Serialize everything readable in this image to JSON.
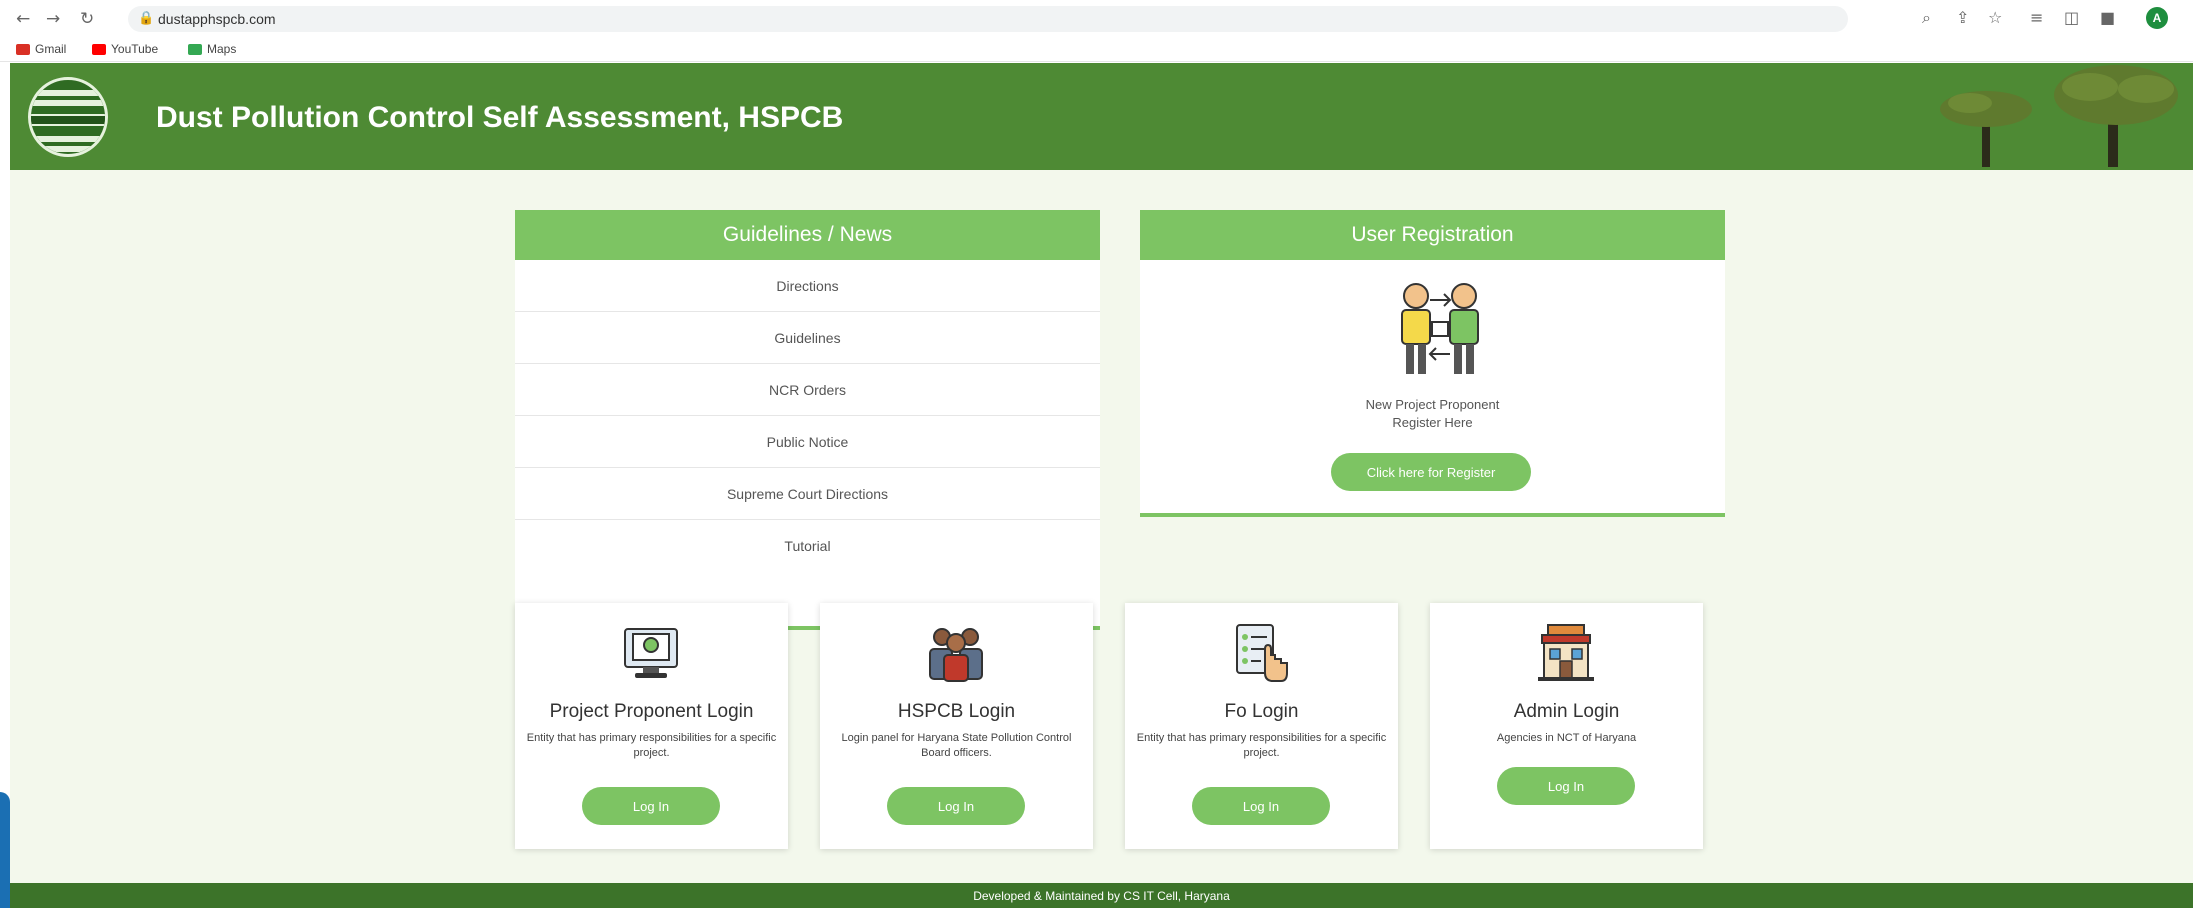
{
  "browser": {
    "url": "dustapphspcb.com",
    "bookmarks": [
      {
        "label": "Gmail",
        "color": "#d93025"
      },
      {
        "label": "YouTube",
        "color": "#ff0000"
      },
      {
        "label": "Maps",
        "color": "#34a853"
      }
    ],
    "avatar_letter": "A"
  },
  "header": {
    "title": "Dust Pollution Control Self Assessment, HSPCB",
    "bg_color": "#4e8a34"
  },
  "guidelines": {
    "heading": "Guidelines / News",
    "items": [
      "Directions",
      "Guidelines",
      "NCR Orders",
      "Public Notice",
      "Supreme Court Directions",
      "Tutorial"
    ]
  },
  "registration": {
    "heading": "User Registration",
    "line1": "New Project Proponent",
    "line2": "Register Here",
    "button_label": "Click here for Register"
  },
  "login_cards": [
    {
      "title": "Project Proponent Login",
      "desc": "Entity that has primary responsibilities for a specific project.",
      "button": "Log In",
      "icon": "computer-certificate-icon"
    },
    {
      "title": "HSPCB Login",
      "desc": "Login panel for Haryana State Pollution Control Board officers.",
      "button": "Log In",
      "icon": "officers-group-icon"
    },
    {
      "title": "Fo Login",
      "desc": "Entity that has primary responsibilities for a specific project.",
      "button": "Log In",
      "icon": "checklist-hand-icon"
    },
    {
      "title": "Admin Login",
      "desc": "Agencies in NCT of Haryana",
      "button": "Log In",
      "icon": "building-icon"
    }
  ],
  "footer": {
    "text": "Developed & Maintained by CS IT Cell, Haryana"
  },
  "colors": {
    "accent": "#7dc463",
    "page_bg": "#f3f8ec",
    "footer": "#3c7329"
  }
}
